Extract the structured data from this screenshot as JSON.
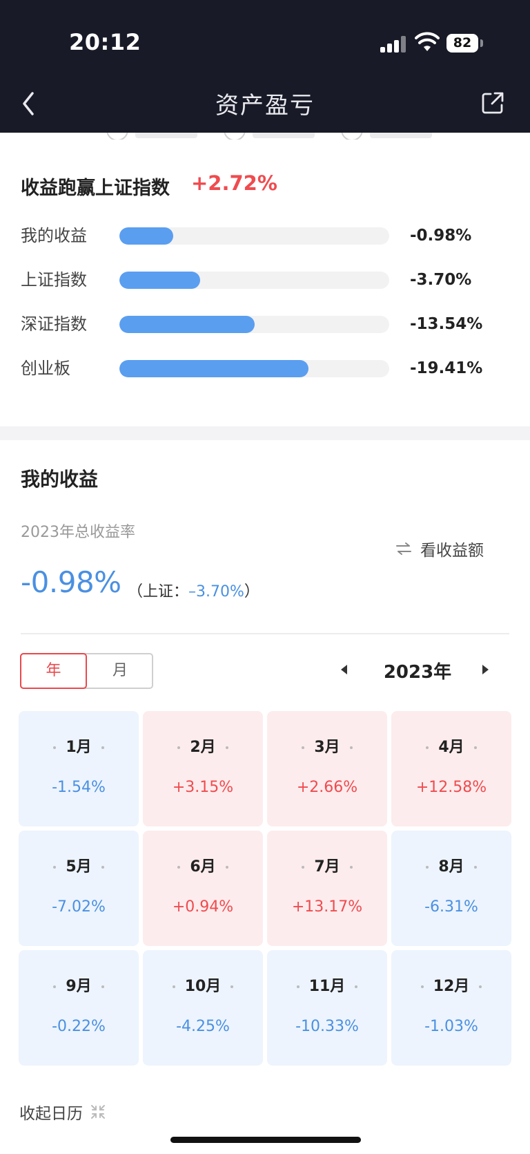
{
  "status_bar": {
    "time": "20:12",
    "battery": "82"
  },
  "nav": {
    "title": "资产盈亏"
  },
  "benchmark": {
    "title": "收益跑赢上证指数",
    "diff": "+2.72%",
    "rows": [
      {
        "label": "我的收益",
        "value": "-0.98%",
        "fill_fraction": 0.2
      },
      {
        "label": "上证指数",
        "value": "-3.70%",
        "fill_fraction": 0.3
      },
      {
        "label": "深证指数",
        "value": "-13.54%",
        "fill_fraction": 0.5
      },
      {
        "label": "创业板",
        "value": "-19.41%",
        "fill_fraction": 0.7
      }
    ]
  },
  "my_earnings": {
    "title": "我的收益",
    "subtitle": "2023年总收益率",
    "toggle_label": "看收益额",
    "rate": "-0.98%",
    "bench_prefix": "（上证：",
    "bench_value": "–3.70%",
    "bench_suffix": "）"
  },
  "segment": {
    "year": "年",
    "month": "月"
  },
  "year_nav": {
    "label": "2023年"
  },
  "months": [
    {
      "name": "1月",
      "value": "-1.54%",
      "sign": "neg"
    },
    {
      "name": "2月",
      "value": "+3.15%",
      "sign": "pos"
    },
    {
      "name": "3月",
      "value": "+2.66%",
      "sign": "pos"
    },
    {
      "name": "4月",
      "value": "+12.58%",
      "sign": "pos"
    },
    {
      "name": "5月",
      "value": "-7.02%",
      "sign": "neg"
    },
    {
      "name": "6月",
      "value": "+0.94%",
      "sign": "pos"
    },
    {
      "name": "7月",
      "value": "+13.17%",
      "sign": "pos"
    },
    {
      "name": "8月",
      "value": "-6.31%",
      "sign": "neg"
    },
    {
      "name": "9月",
      "value": "-0.22%",
      "sign": "neg"
    },
    {
      "name": "10月",
      "value": "-4.25%",
      "sign": "neg"
    },
    {
      "name": "11月",
      "value": "-10.33%",
      "sign": "neg"
    },
    {
      "name": "12月",
      "value": "-1.03%",
      "sign": "neg"
    }
  ],
  "collapse": {
    "label": "收起日历"
  },
  "colors": {
    "header_bg": "#181b27",
    "positive": "#ef4b4f",
    "negative": "#4a90e2",
    "bar_fill": "#5a9ef0"
  }
}
